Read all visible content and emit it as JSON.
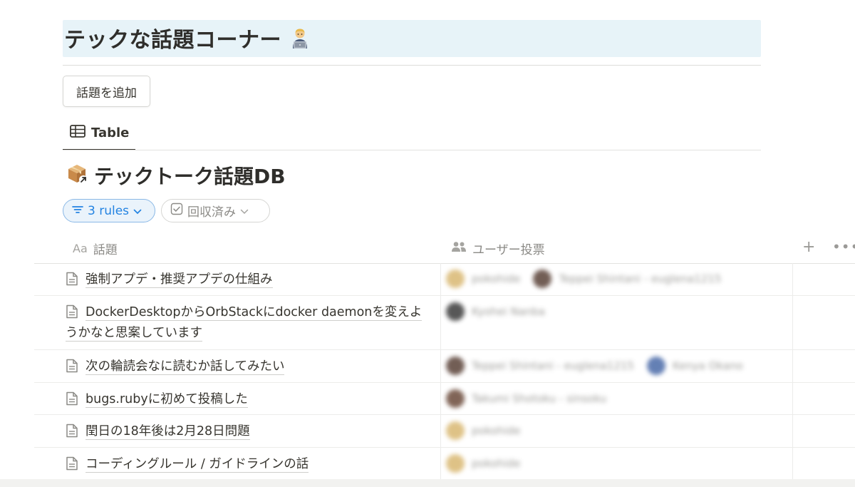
{
  "page": {
    "heading": "テックな話題コーナー",
    "heading_emoji": "technologist-emoji",
    "add_button": "話題を追加"
  },
  "view_tabs": [
    {
      "label": "Table",
      "icon": "table-icon",
      "active": true
    }
  ],
  "database": {
    "title": "テックトーク話題DB",
    "icon": "package-link-icon"
  },
  "filters": {
    "rules_label": "3 rules",
    "collected_label": "回収済み"
  },
  "columns": {
    "title_prefix": "Aa",
    "title": "話題",
    "votes": "ユーザー投票"
  },
  "colors": {
    "accent_blue": "#2383e2",
    "heading_bg": "#e7f3f8",
    "text": "#37352f",
    "muted": "#8b8a86"
  },
  "rows": [
    {
      "title": "強制アプデ・推奨アプデの仕組み",
      "voters": [
        {
          "name": "pokohide",
          "avatar_color": "#d9b872"
        },
        {
          "name": "Teppei Shintani - euglena1215",
          "avatar_color": "#5a4238"
        }
      ]
    },
    {
      "title": "DockerDesktopからOrbStackにdocker daemonを変えようかなと思案しています",
      "voters": [
        {
          "name": "Kyohei Nanba",
          "avatar_color": "#3a3a3a"
        }
      ]
    },
    {
      "title": "次の輪読会なに読むか話してみたい",
      "voters": [
        {
          "name": "Teppei Shintani - euglena1215",
          "avatar_color": "#5a4238"
        },
        {
          "name": "Kenya Okano",
          "avatar_color": "#4a6aa8"
        }
      ]
    },
    {
      "title": "bugs.rubyに初めて投稿した",
      "voters": [
        {
          "name": "Takumi Shotoku - sinsoku",
          "avatar_color": "#6b4a3a"
        }
      ]
    },
    {
      "title": "閏日の18年後は2月28日問題",
      "voters": [
        {
          "name": "pokohide",
          "avatar_color": "#d9b872"
        }
      ]
    },
    {
      "title": "コーディングルール / ガイドラインの話",
      "voters": [
        {
          "name": "pokohide",
          "avatar_color": "#d9b872"
        }
      ]
    }
  ]
}
